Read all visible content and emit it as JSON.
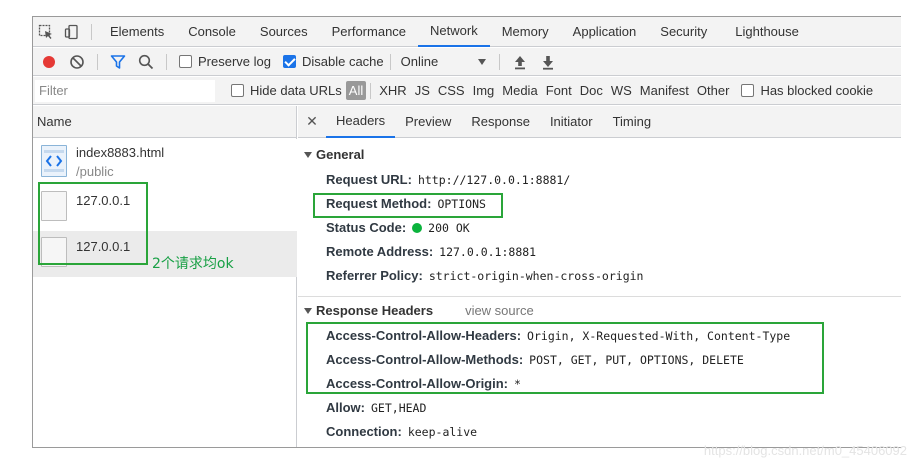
{
  "devtools_tabs": [
    "Elements",
    "Console",
    "Sources",
    "Performance",
    "Network",
    "Memory",
    "Application",
    "Security",
    "Lighthouse"
  ],
  "active_tab": "Network",
  "toolbar": {
    "preserve_log": "Preserve log",
    "disable_cache": "Disable cache",
    "throttling": "Online"
  },
  "filterbar": {
    "placeholder": "Filter",
    "hide_data_urls": "Hide data URLs",
    "all": "All",
    "types": [
      "XHR",
      "JS",
      "CSS",
      "Img",
      "Media",
      "Font",
      "Doc",
      "WS",
      "Manifest",
      "Other"
    ],
    "has_blocked": "Has blocked cookie"
  },
  "requests": {
    "column": "Name",
    "items": [
      {
        "name": "index8883.html",
        "sub": "/public"
      },
      {
        "name": "127.0.0.1",
        "sub": ""
      },
      {
        "name": "127.0.0.1",
        "sub": ""
      }
    ]
  },
  "detail_tabs": [
    "Headers",
    "Preview",
    "Response",
    "Initiator",
    "Timing"
  ],
  "general": {
    "title": "General",
    "rows": [
      {
        "key": "Request URL:",
        "value": "http://127.0.0.1:8881/"
      },
      {
        "key": "Request Method:",
        "value": "OPTIONS"
      },
      {
        "key": "Status Code:",
        "value": "200 OK"
      },
      {
        "key": "Remote Address:",
        "value": "127.0.0.1:8881"
      },
      {
        "key": "Referrer Policy:",
        "value": "strict-origin-when-cross-origin"
      }
    ]
  },
  "response_headers": {
    "title": "Response Headers",
    "view_source": "view source",
    "rows": [
      {
        "key": "Access-Control-Allow-Headers:",
        "value": "Origin, X-Requested-With, Content-Type"
      },
      {
        "key": "Access-Control-Allow-Methods:",
        "value": "POST, GET, PUT, OPTIONS, DELETE"
      },
      {
        "key": "Access-Control-Allow-Origin:",
        "value": "*"
      },
      {
        "key": "Allow:",
        "value": "GET,HEAD"
      },
      {
        "key": "Connection:",
        "value": "keep-alive"
      }
    ]
  },
  "annotation": "2个请求均ok",
  "watermark": "https://blog.csdn.net/m0_45406092",
  "colors": {
    "accent": "#1a73e8",
    "annotation": "#2aa539",
    "status_ok": "#0bb33d",
    "record": "#e53935"
  }
}
